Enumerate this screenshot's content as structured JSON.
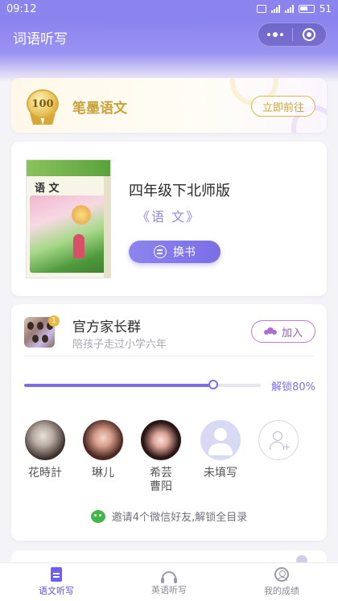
{
  "status_bar": {
    "time": "09:12",
    "battery": "51"
  },
  "header": {
    "title": "词语听写"
  },
  "promo": {
    "medal_text": "100",
    "title": "笔墨语文",
    "button": "立即前往"
  },
  "book": {
    "cover_title": "语 文",
    "title": "四年级下北师版",
    "subtitle": "《语 文》",
    "swap_button": "换书"
  },
  "group": {
    "badge": "1",
    "name": "官方家长群",
    "subtitle": "陪孩子走过小学六年",
    "join_button": "加入",
    "unlock_text": "解锁80%",
    "unlock_progress": 0.8,
    "members": [
      {
        "name": "花時計",
        "type": "photo1"
      },
      {
        "name": "琳儿",
        "type": "photo2"
      },
      {
        "name": "希芸曹阳",
        "type": "photo3"
      },
      {
        "name": "未填写",
        "type": "empty"
      },
      {
        "name": "",
        "type": "invite"
      }
    ],
    "invite_tip": "邀请4个微信好友,解锁全目录"
  },
  "tabs": [
    {
      "label": "语文听写",
      "icon": "document-icon",
      "active": true
    },
    {
      "label": "英语听写",
      "icon": "headphones-icon",
      "active": false
    },
    {
      "label": "我的成绩",
      "icon": "user-icon",
      "active": false
    }
  ],
  "colors": {
    "accent": "#7a6fe6",
    "gold": "#c9a23a",
    "join": "#9a52cc"
  }
}
